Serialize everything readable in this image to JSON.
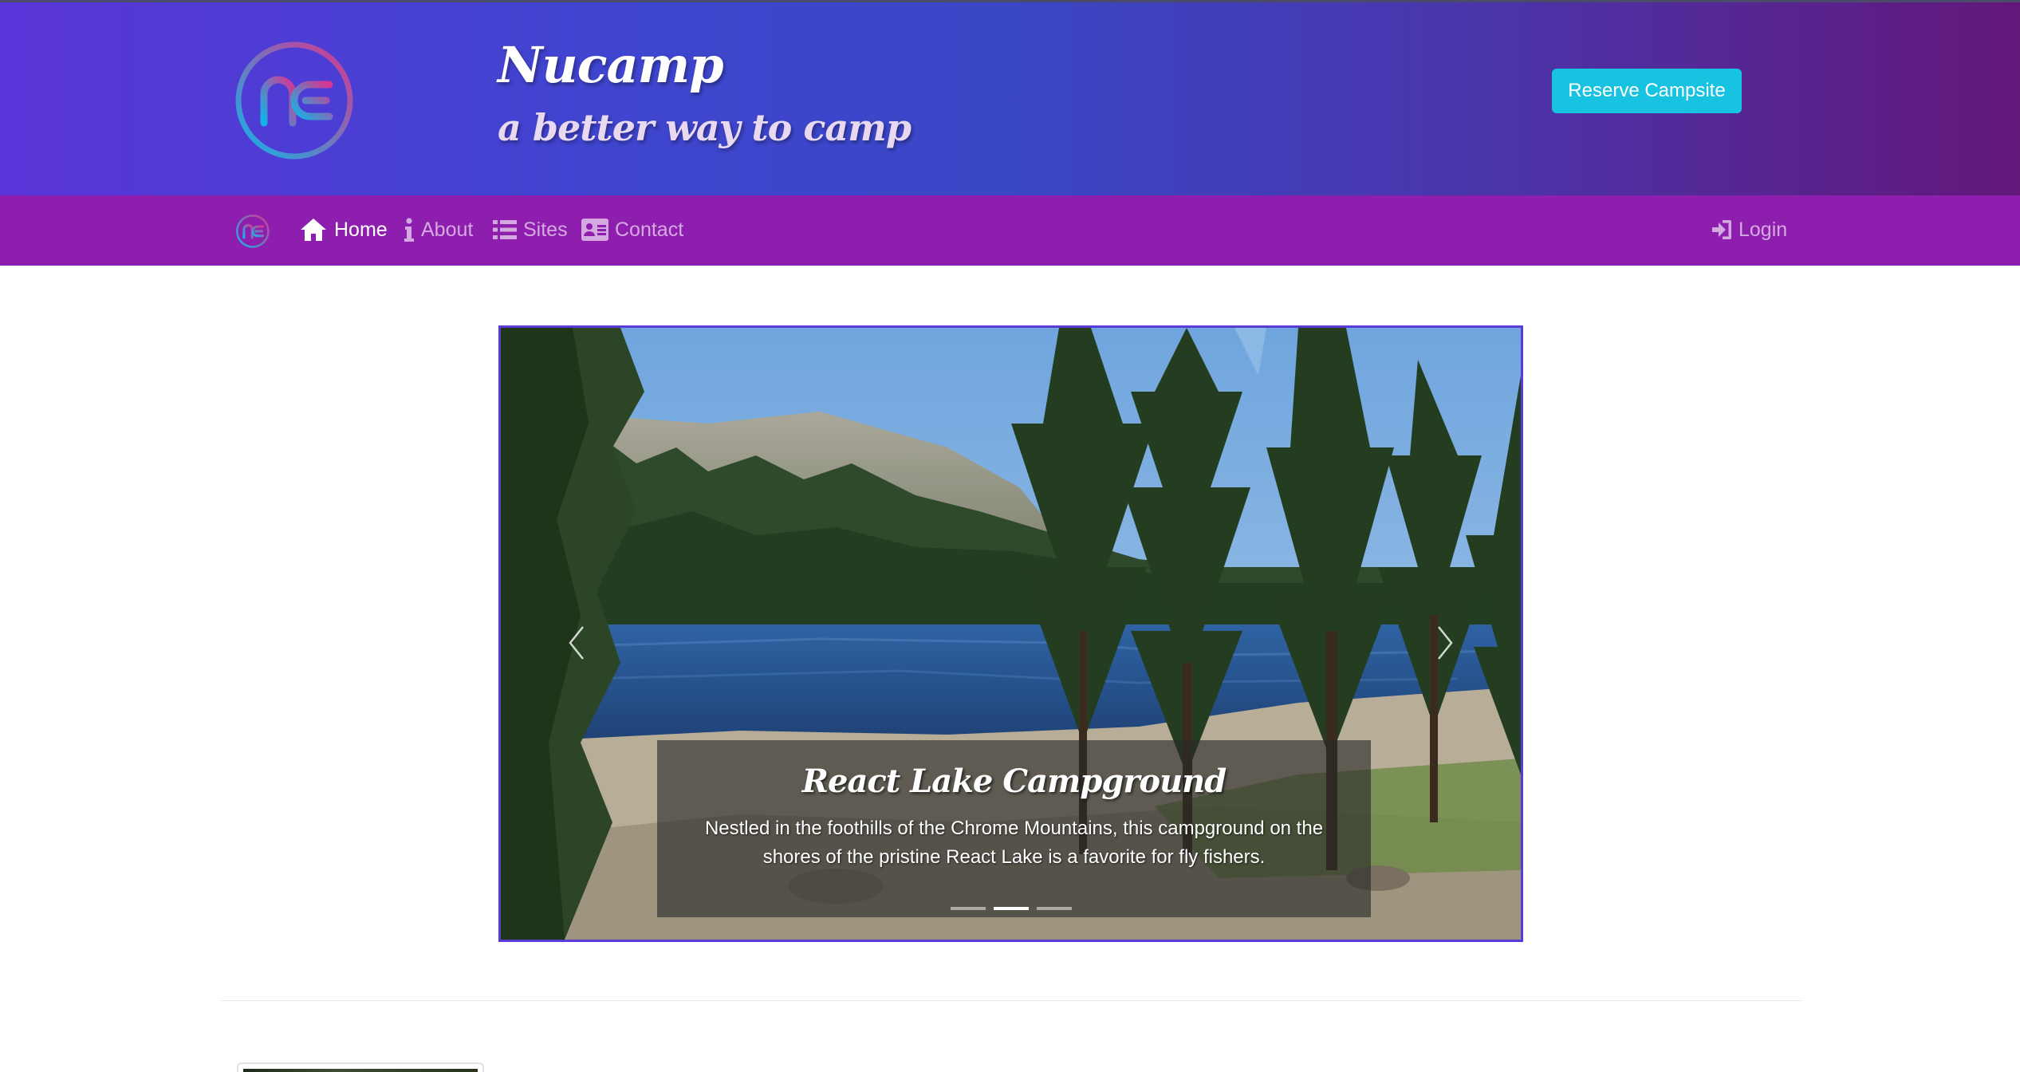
{
  "header": {
    "logo_icon": "nucamp-logo-icon",
    "title": "Nucamp",
    "tagline": "a better way to camp",
    "reserve_button": "Reserve Campsite"
  },
  "nav": {
    "logo_icon": "nucamp-logo-icon",
    "items": [
      {
        "label": "Home",
        "icon": "home-icon",
        "active": true
      },
      {
        "label": "About",
        "icon": "info-icon",
        "active": false
      },
      {
        "label": "Sites",
        "icon": "list-icon",
        "active": false
      },
      {
        "label": "Contact",
        "icon": "address-card-icon",
        "active": false
      }
    ],
    "login": {
      "label": "Login",
      "icon": "sign-in-icon"
    }
  },
  "carousel": {
    "title": "React Lake Campground",
    "text": "Nestled in the foothills of the Chrome Mountains, this campground on the shores of the pristine React Lake is a favorite for fly fishers.",
    "prev_icon": "chevron-left-icon",
    "next_icon": "chevron-right-icon",
    "slide_count": 3,
    "active_slide": 2
  },
  "colors": {
    "header_gradient_start": "#5a35d9",
    "header_gradient_end": "#63177a",
    "navbar": "#8e1eae",
    "reserve_button": "#17c3e0",
    "carousel_border": "#5b3bd6"
  }
}
